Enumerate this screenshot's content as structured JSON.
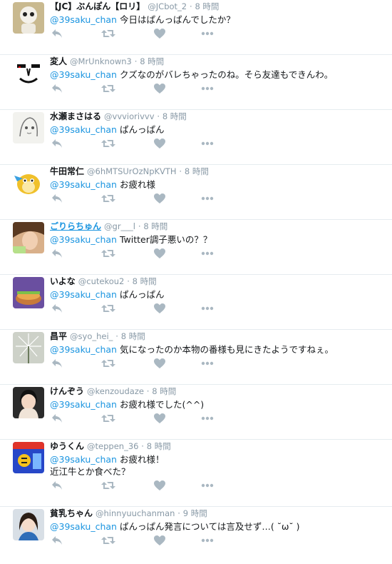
{
  "colors": {
    "mention": "#1b95e0",
    "meta": "#8899a6",
    "icon": "#aab8c2",
    "divider": "#e6ecf0"
  },
  "tweets": [
    {
      "name": "【JC】ぶんぽん【ロリ】",
      "handle": "@JCbot_2",
      "dot": "·",
      "time": "8 時間",
      "mention": "@39saku_chan",
      "text": "今日はぱんっぱんでしたか？",
      "text2": "",
      "avatar_icon": "robot-avatar"
    },
    {
      "name": "変人",
      "handle": "@MrUnknown3",
      "dot": "·",
      "time": "8 時間",
      "mention": "@39saku_chan",
      "text": "クズなのがバレちゃったのね。そら友達もできんわ。",
      "text2": "",
      "avatar_icon": "face-sketch-avatar"
    },
    {
      "name": "水瀬まさはる",
      "handle": "@vvviorivvv",
      "dot": "·",
      "time": "8 時間",
      "mention": "@39saku_chan",
      "text": "ぱんっぱん",
      "text2": "",
      "avatar_icon": "anime-sketch-avatar"
    },
    {
      "name": "牛田常仁",
      "handle": "@6hMTSUrOzNpKVTH",
      "dot": "·",
      "time": "8 時間",
      "mention": "@39saku_chan",
      "text": "お疲れ様",
      "text2": "",
      "avatar_icon": "bird-character-avatar"
    },
    {
      "name": "ごりらちゅん",
      "handle": "@gr___l",
      "dot": "·",
      "time": "8 時間",
      "mention": "@39saku_chan",
      "text": "Twitter調子悪いの？？",
      "text2": "",
      "avatar_icon": "photo-avatar"
    },
    {
      "name": "いよな",
      "handle": "@cutekou2",
      "dot": "·",
      "time": "8 時間",
      "mention": "@39saku_chan",
      "text": "ぱんっぱん",
      "text2": "",
      "avatar_icon": "food-avatar"
    },
    {
      "name": "昌平",
      "handle": "@syo_hei_",
      "dot": "·",
      "time": "8 時間",
      "mention": "@39saku_chan",
      "text": "気になったのか本物の番様も見にきたようですねぇ。",
      "text2": "",
      "avatar_icon": "flower-avatar"
    },
    {
      "name": "けんぞう",
      "handle": "@kenzoudaze",
      "dot": "·",
      "time": "8 時間",
      "mention": "@39saku_chan",
      "text": "お疲れ様でした(^^)",
      "text2": "",
      "avatar_icon": "person-avatar"
    },
    {
      "name": "ゆうくん",
      "handle": "@teppen_36",
      "dot": "·",
      "time": "8 時間",
      "mention": "@39saku_chan",
      "text": "お疲れ様！",
      "text2": "近江牛とか食べた？",
      "avatar_icon": "game-avatar"
    },
    {
      "name": "貧乳ちゃん",
      "handle": "@hinnyuuchanman",
      "dot": "·",
      "time": "9 時間",
      "mention": "@39saku_chan",
      "text": "ぱんっぱん発言については言及せず…( ˘ω˘ )",
      "text2": "",
      "avatar_icon": "girl-avatar"
    }
  ]
}
